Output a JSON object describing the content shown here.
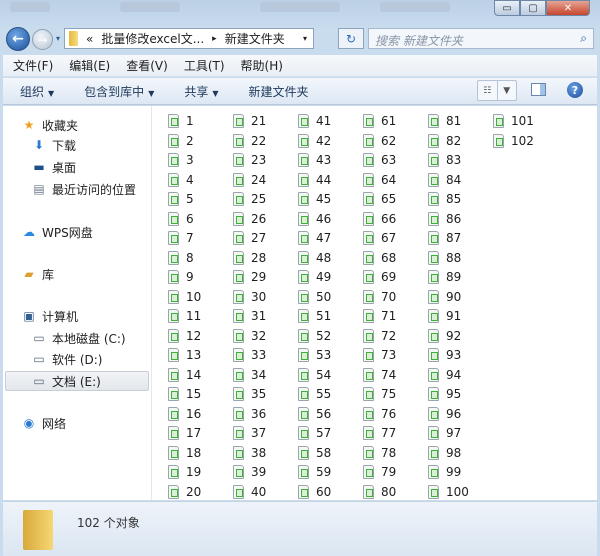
{
  "window": {
    "minimize": "▭",
    "maximize": "▢",
    "close": "✕"
  },
  "nav": {
    "back": "←",
    "forward": "→",
    "history": "▾",
    "breadcrumb_prefix": "«",
    "breadcrumb_parent": "批量修改excel文...",
    "breadcrumb_sep": "▸",
    "breadcrumb_current": "新建文件夹",
    "dropdown": "▾",
    "refresh": "↻",
    "search_placeholder": "搜索 新建文件夹",
    "search_icon": "⌕"
  },
  "menu": [
    "文件(F)",
    "编辑(E)",
    "查看(V)",
    "工具(T)",
    "帮助(H)"
  ],
  "toolbar": {
    "organize": "组织",
    "include": "包含到库中",
    "share": "共享",
    "new_folder": "新建文件夹",
    "arrow": "▼",
    "help": "?"
  },
  "sidebar": [
    {
      "label": "收藏夹",
      "icon": "★",
      "color": "#f0a020"
    },
    {
      "label": "下载",
      "icon": "⬇",
      "color": "#2a7ad0"
    },
    {
      "label": "桌面",
      "icon": "▬",
      "color": "#1d4f8a"
    },
    {
      "label": "最近访问的位置",
      "icon": "▤",
      "color": "#6a7a8a"
    },
    {
      "label": "WPS网盘",
      "icon": "☁",
      "color": "#2a8ae0"
    },
    {
      "label": "库",
      "icon": "▰",
      "color": "#d9a030"
    },
    {
      "label": "计算机",
      "icon": "▣",
      "color": "#34608f"
    },
    {
      "label": "本地磁盘 (C:)",
      "icon": "▭",
      "color": "#5a6a7a"
    },
    {
      "label": "软件 (D:)",
      "icon": "▭",
      "color": "#5a6a7a"
    },
    {
      "label": "文档 (E:)",
      "icon": "▭",
      "color": "#5a6a7a",
      "selected": true
    },
    {
      "label": "网络",
      "icon": "◉",
      "color": "#2a7ad0"
    }
  ],
  "files": [
    "1",
    "2",
    "3",
    "4",
    "5",
    "6",
    "7",
    "8",
    "9",
    "10",
    "11",
    "12",
    "13",
    "14",
    "15",
    "16",
    "17",
    "18",
    "19",
    "20",
    "21",
    "22",
    "23",
    "24",
    "25",
    "26",
    "27",
    "28",
    "29",
    "30",
    "31",
    "32",
    "33",
    "34",
    "35",
    "36",
    "37",
    "38",
    "39",
    "40",
    "41",
    "42",
    "43",
    "44",
    "45",
    "46",
    "47",
    "48",
    "49",
    "50",
    "51",
    "52",
    "53",
    "54",
    "55",
    "56",
    "57",
    "58",
    "59",
    "60",
    "61",
    "62",
    "63",
    "64",
    "65",
    "66",
    "67",
    "68",
    "69",
    "70",
    "71",
    "72",
    "73",
    "74",
    "75",
    "76",
    "77",
    "78",
    "79",
    "80",
    "81",
    "82",
    "83",
    "84",
    "85",
    "86",
    "87",
    "88",
    "89",
    "90",
    "91",
    "92",
    "93",
    "94",
    "95",
    "96",
    "97",
    "98",
    "99",
    "100",
    "101",
    "102"
  ],
  "status": {
    "count": "102 个对象"
  }
}
